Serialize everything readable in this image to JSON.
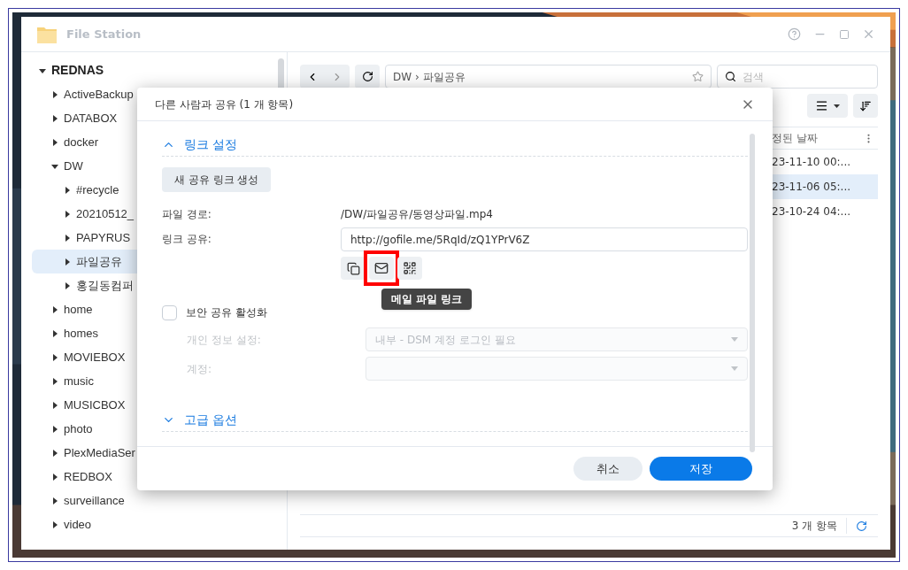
{
  "window": {
    "title": "File Station"
  },
  "toolbar": {
    "path": "DW › 파일공유",
    "search": {
      "placeholder": "검색"
    }
  },
  "sidebar": {
    "items": [
      {
        "label": "REDNAS",
        "expanded": true,
        "selected": false,
        "children": [
          {
            "label": "ActiveBackup",
            "expanded": false,
            "selected": false
          },
          {
            "label": "DATABOX",
            "expanded": false,
            "selected": false
          },
          {
            "label": "docker",
            "expanded": false,
            "selected": false
          },
          {
            "label": "DW",
            "expanded": true,
            "selected": false,
            "children": [
              {
                "label": "#recycle",
                "expanded": false,
                "selected": false
              },
              {
                "label": "20210512_",
                "expanded": false,
                "selected": false
              },
              {
                "label": "PAPYRUS",
                "expanded": false,
                "selected": false
              },
              {
                "label": "파일공유",
                "expanded": false,
                "selected": true
              },
              {
                "label": "홍길동컴퍼",
                "expanded": false,
                "selected": false
              }
            ]
          },
          {
            "label": "home",
            "expanded": false,
            "selected": false
          },
          {
            "label": "homes",
            "expanded": false,
            "selected": false
          },
          {
            "label": "MOVIEBOX",
            "expanded": false,
            "selected": false
          },
          {
            "label": "music",
            "expanded": false,
            "selected": false
          },
          {
            "label": "MUSICBOX",
            "expanded": false,
            "selected": false
          },
          {
            "label": "photo",
            "expanded": false,
            "selected": false
          },
          {
            "label": "PlexMediaSer",
            "expanded": false,
            "selected": false
          },
          {
            "label": "REDBOX",
            "expanded": false,
            "selected": false
          },
          {
            "label": "surveillance",
            "expanded": false,
            "selected": false
          },
          {
            "label": "video",
            "expanded": false,
            "selected": false
          }
        ]
      }
    ]
  },
  "table": {
    "columns": [
      "정된 날짜"
    ],
    "rows": [
      {
        "cells": [
          "23-11-10 00:..."
        ],
        "selected": false
      },
      {
        "cells": [
          "23-11-06 05:..."
        ],
        "selected": true
      },
      {
        "cells": [
          "23-10-24 04:..."
        ],
        "selected": false
      }
    ]
  },
  "status_bar": {
    "count": "3 개 항목"
  },
  "dialog": {
    "title": "다른 사람과 공유 (1 개 항목)",
    "sections": [
      {
        "title": "링크 설정",
        "expanded": true
      },
      {
        "title": "고급 옵션",
        "expanded": false
      }
    ],
    "generate_button": "새 공유 링크 생성",
    "file_path": {
      "label": "파일 경로:",
      "value": "/DW/파일공유/동영상파일.mp4"
    },
    "link": {
      "label": "링크 공유:",
      "value": "http://gofile.me/5RqId/zQ1YPrV6Z"
    },
    "link_actions": [
      {
        "kind": "copy",
        "highlighted": false
      },
      {
        "kind": "mail",
        "highlighted": true
      },
      {
        "kind": "qr",
        "highlighted": false
      }
    ],
    "tooltip": "메일 파일 링크",
    "secure_share": {
      "label": "보안 공유 활성화",
      "checked": false
    },
    "privacy": {
      "label": "개인 정보 설정:",
      "value": "내부 - DSM 계정 로그인 필요",
      "disabled": true
    },
    "account": {
      "label": "계정:",
      "disabled": true
    },
    "buttons": [
      {
        "kind": "cancel",
        "label": "취소"
      },
      {
        "kind": "save",
        "label": "저장"
      }
    ]
  }
}
